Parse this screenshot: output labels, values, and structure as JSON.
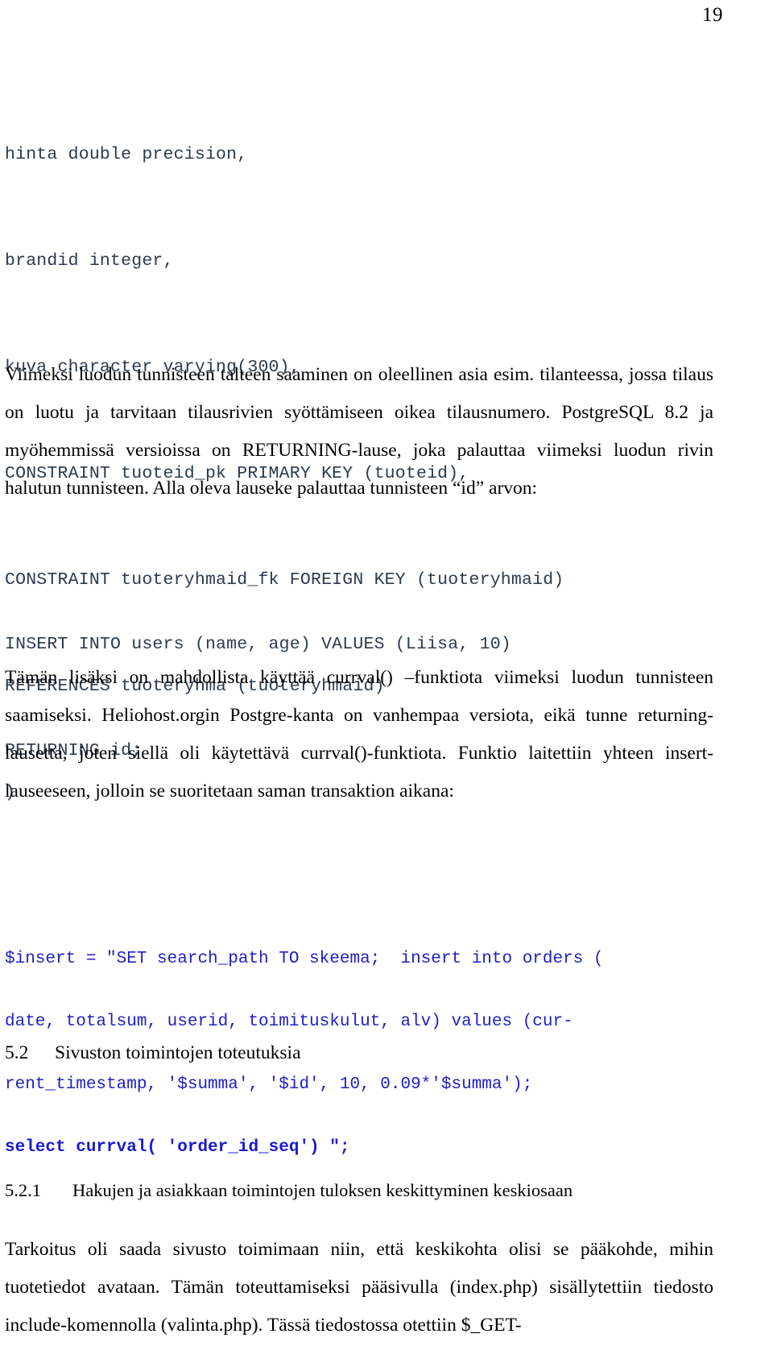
{
  "page": {
    "number": "19"
  },
  "ddl_code": {
    "lines": [
      "hinta double precision,",
      "brandid integer,",
      "kuva character varying(300),",
      "CONSTRAINT tuoteid_pk PRIMARY KEY (tuoteid),",
      "CONSTRAINT tuoteryhmaid_fk FOREIGN KEY (tuoteryhmaid)",
      "REFERENCES tuoteryhma (tuoteryhmaid)",
      ")"
    ]
  },
  "paragraph_1": "Viimeksi luodun tunnisteen talteen saaminen on oleellinen asia esim. tilanteessa, jossa tilaus on luotu ja tarvitaan tilausrivien syöttämiseen oikea tilausnumero. PostgreSQL 8.2  ja myöhemmissä versioissa on RETURNING-lause, joka palauttaa viimeksi luodun rivin halutun tunnisteen. Alla oleva lauseke palauttaa tunnisteen “id” arvon:",
  "insert_code": {
    "lines": [
      "INSERT INTO users (name, age) VALUES (Liisa, 10)",
      "RETURNING id;"
    ]
  },
  "paragraph_2": "Tämän lisäksi on mahdollista käyttää currval() –funktiota viimeksi luodun tunnisteen saamiseksi. Heliohost.orgin Postgre-kanta on vanhempaa versiota, eikä tunne returning-lausetta, joten siellä oli käytettävä currval()-funktiota. Funktio laitettiin yhteen insert-lauseeseen, jolloin se suoritetaan saman transaktion aikana:",
  "php_code": {
    "lines": [
      "$insert = \"SET search_path TO skeema;  insert into orders (",
      "date, totalsum, userid, toimituskulut, alv) values (cur-",
      "rent_timestamp, '$summa', '$id', 10, 0.09*'$summa');"
    ],
    "bold_line": "select currval( 'order_id_seq') \";"
  },
  "heading_5_2": {
    "number": "5.2",
    "title": "Sivuston toimintojen toteutuksia"
  },
  "heading_5_2_1": {
    "number": "5.2.1",
    "title": "Hakujen ja asiakkaan toimintojen tuloksen keskittyminen keskiosaan"
  },
  "paragraph_3": "Tarkoitus oli saada sivusto toimimaan niin, että keskikohta olisi se pääkohde, mihin tuotetiedot avataan. Tämän toteuttamiseksi pääsivulla (index.php) sisällytettiin tiedosto include-komennolla (valinta.php). Tässä tiedostossa otettiin $_GET-",
  "colors": {
    "ddl_code": "#2b3b4e",
    "php_code": "#2020c8",
    "body_text": "#000000",
    "page_background": "#ffffff"
  }
}
